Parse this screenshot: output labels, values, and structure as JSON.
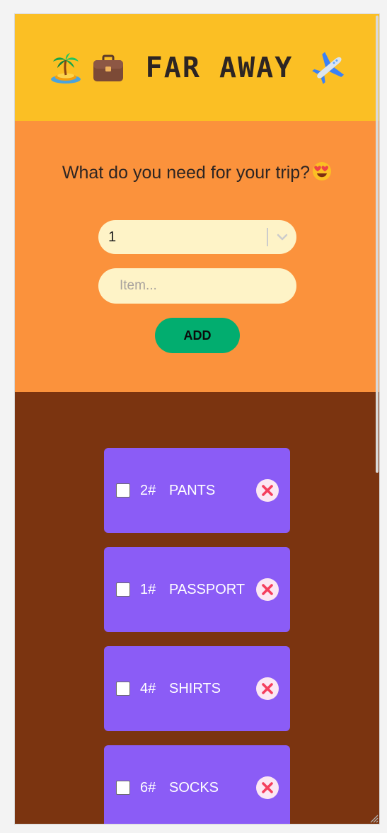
{
  "app": {
    "title": "FAR AWAY",
    "header_icons": [
      "island-palm-icon",
      "briefcase-icon",
      "airplane-icon"
    ]
  },
  "form": {
    "question": "What do you need for your trip?",
    "question_icon": "heart-eyes-icon",
    "quantity_value": "1",
    "item_placeholder": "Item...",
    "add_label": "ADD"
  },
  "list": {
    "items": [
      {
        "qty": "2#",
        "name": "pants",
        "packed": false
      },
      {
        "qty": "1#",
        "name": "passport",
        "packed": false
      },
      {
        "qty": "4#",
        "name": "shirts",
        "packed": false
      },
      {
        "qty": "6#",
        "name": "socks",
        "packed": false
      }
    ]
  },
  "colors": {
    "header_bg": "#fbbf24",
    "form_bg": "#fb923c",
    "list_bg": "#7b3410",
    "item_bg": "#8b5cf6",
    "add_button": "#02ad6f",
    "field_bg": "#fef3c7"
  }
}
